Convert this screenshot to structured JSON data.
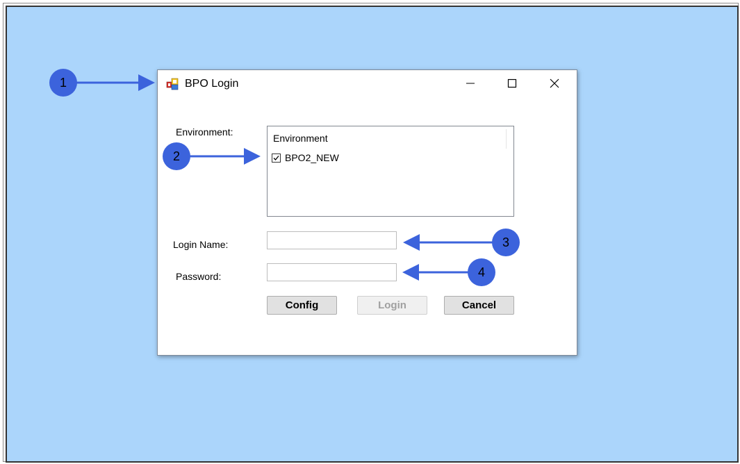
{
  "window": {
    "title": "BPO Login",
    "controls": {
      "minimize": "minimize",
      "maximize": "maximize",
      "close": "close"
    }
  },
  "form": {
    "environment_label": "Environment:",
    "environment_list": {
      "header": "Environment",
      "items": [
        {
          "label": "BPO2_NEW",
          "checked": true
        }
      ]
    },
    "login_name_label": "Login Name:",
    "login_name_value": "",
    "password_label": "Password:",
    "password_value": ""
  },
  "buttons": {
    "config": "Config",
    "login": "Login",
    "cancel": "Cancel"
  },
  "annotations": [
    "1",
    "2",
    "3",
    "4"
  ],
  "colors": {
    "background": "#abd5fb",
    "annotation": "#3c63dc"
  },
  "icons": {
    "app": "app-icon",
    "minimize": "minimize-icon",
    "maximize": "maximize-icon",
    "close": "close-icon",
    "checkbox": "checkmark-icon"
  }
}
